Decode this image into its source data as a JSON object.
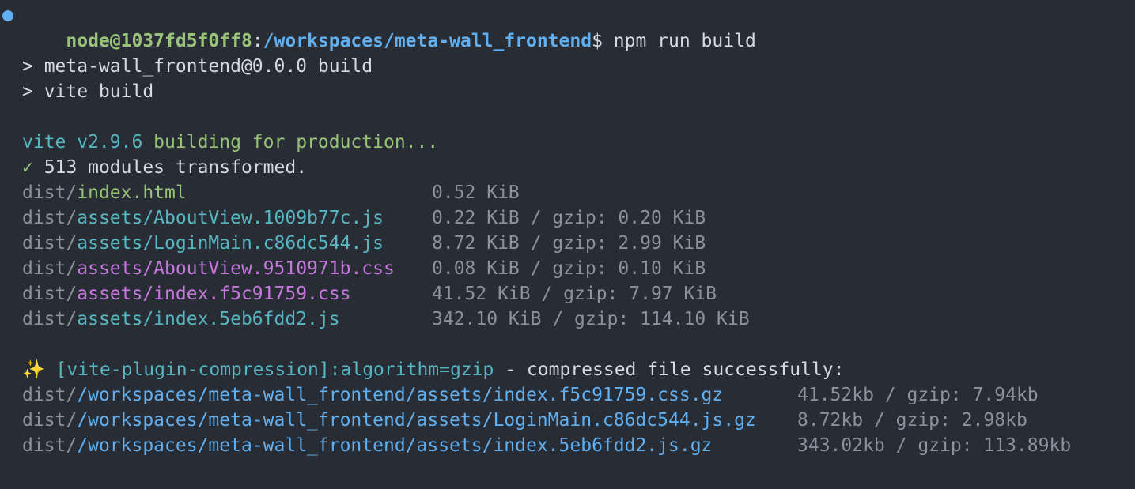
{
  "colors": {
    "background": "#282c34",
    "foreground": "#d7dae0",
    "prompt_user": "#98c379",
    "prompt_path": "#61afef",
    "dot": "#61afef",
    "vite_cyan": "#56b6c2",
    "vite_green": "#98c379",
    "dim": "#8b929e",
    "html_file": "#98c379",
    "js_file": "#56b6c2",
    "css_file": "#c678dd",
    "plugin_path": "#61afef",
    "sparkle": "#e5c07b"
  },
  "prompt": {
    "user_host": "node@1037fd5f0ff8",
    "separator": ":",
    "path": "/workspaces/meta-wall_frontend",
    "symbol": "$",
    "command": " npm run build"
  },
  "script_lines": [
    "> meta-wall_frontend@0.0.0 build",
    "> vite build"
  ],
  "vite": {
    "version_text": "vite v2.9.6",
    "building_text": " building for production...",
    "check_icon": "✓",
    "transformed_text": " 513 modules transformed."
  },
  "dist_files": [
    {
      "prefix": "dist/",
      "name": "index.html",
      "kind": "html",
      "size": "0.52 KiB"
    },
    {
      "prefix": "dist/",
      "name": "assets/AboutView.1009b77c.js",
      "kind": "js",
      "size": "0.22 KiB / gzip: 0.20 KiB"
    },
    {
      "prefix": "dist/",
      "name": "assets/LoginMain.c86dc544.js",
      "kind": "js",
      "size": "8.72 KiB / gzip: 2.99 KiB"
    },
    {
      "prefix": "dist/",
      "name": "assets/AboutView.9510971b.css",
      "kind": "css",
      "size": "0.08 KiB / gzip: 0.10 KiB"
    },
    {
      "prefix": "dist/",
      "name": "assets/index.f5c91759.css",
      "kind": "css",
      "size": "41.52 KiB / gzip: 7.97 KiB"
    },
    {
      "prefix": "dist/",
      "name": "assets/index.5eb6fdd2.js",
      "kind": "js",
      "size": "342.10 KiB / gzip: 114.10 KiB"
    }
  ],
  "compression": {
    "sparkle_icon": "✨",
    "plugin_text": " [vite-plugin-compression]:algorithm=gzip",
    "message_text": " - compressed file successfully:"
  },
  "compressed_files": [
    {
      "prefix": "dist/",
      "path": "/workspaces/meta-wall_frontend/assets/index.f5c91759.css.gz",
      "size": "41.52kb / gzip: 7.94kb"
    },
    {
      "prefix": "dist/",
      "path": "/workspaces/meta-wall_frontend/assets/LoginMain.c86dc544.js.gz",
      "size": "8.72kb / gzip: 2.98kb"
    },
    {
      "prefix": "dist/",
      "path": "/workspaces/meta-wall_frontend/assets/index.5eb6fdd2.js.gz",
      "size": "343.02kb / gzip: 113.89kb"
    }
  ]
}
